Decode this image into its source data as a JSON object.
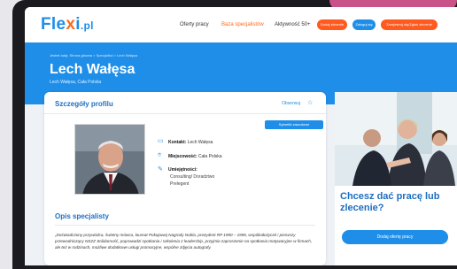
{
  "nav": {
    "logo_main": "Fle",
    "logo_x": "x",
    "logo_end": "i",
    "logo_tld": ".pl",
    "links": [
      "Oferty pracy",
      "Baza specjalistów",
      "Aktywność 50+"
    ],
    "active_link": "Baza specjalistów",
    "buttons": [
      "Dodaj zlecenie",
      "Zaloguj się",
      "Zarejestruj się/Zgłoś zlecenie"
    ]
  },
  "hero": {
    "breadcrumb": "Jesteś tutaj: Strona główna > Specjaliści > Lech Wałęsa",
    "title": "Lech Wałęsa",
    "subtitle": "Lech Wałęsa, Cała Polska"
  },
  "profile": {
    "title": "Szczegóły profilu",
    "observe_label": "Obserwuj",
    "tooltip": "Sylwetki zawodowe",
    "contact_label": "Kontakt:",
    "contact_value": "Lech Wałęsa",
    "location_label": "Miejscowość:",
    "location_value": "Cała Polska",
    "skills_label": "Umiejętności:",
    "skills": [
      "Consulting/ Doradztwo",
      "Prelegent"
    ]
  },
  "specialist": {
    "title": "Opis specjalisty",
    "text": "„Doświadczony przywódca, świetny mówca, laureat Pokojowej Nagrody Nobla, prezydent RP 1990 – 1995, współzałożyciel i pierwszy przewodniczący NSZZ Solidarność, poprowadzi spotkania i szkolenia z leadership, przyjmie zaproszenie na spotkania motywacyjne w firmach, ale też w rodzinach, możliwe dodatkowe usługi promocyjne, wspólne zdjęcia autografy."
  },
  "promo": {
    "title": "Chcesz dać pracę lub zlecenie?",
    "button": "Dodaj ofertę pracy"
  },
  "colors": {
    "brand_blue": "#1e8ee8",
    "brand_orange": "#ff5a1f"
  }
}
